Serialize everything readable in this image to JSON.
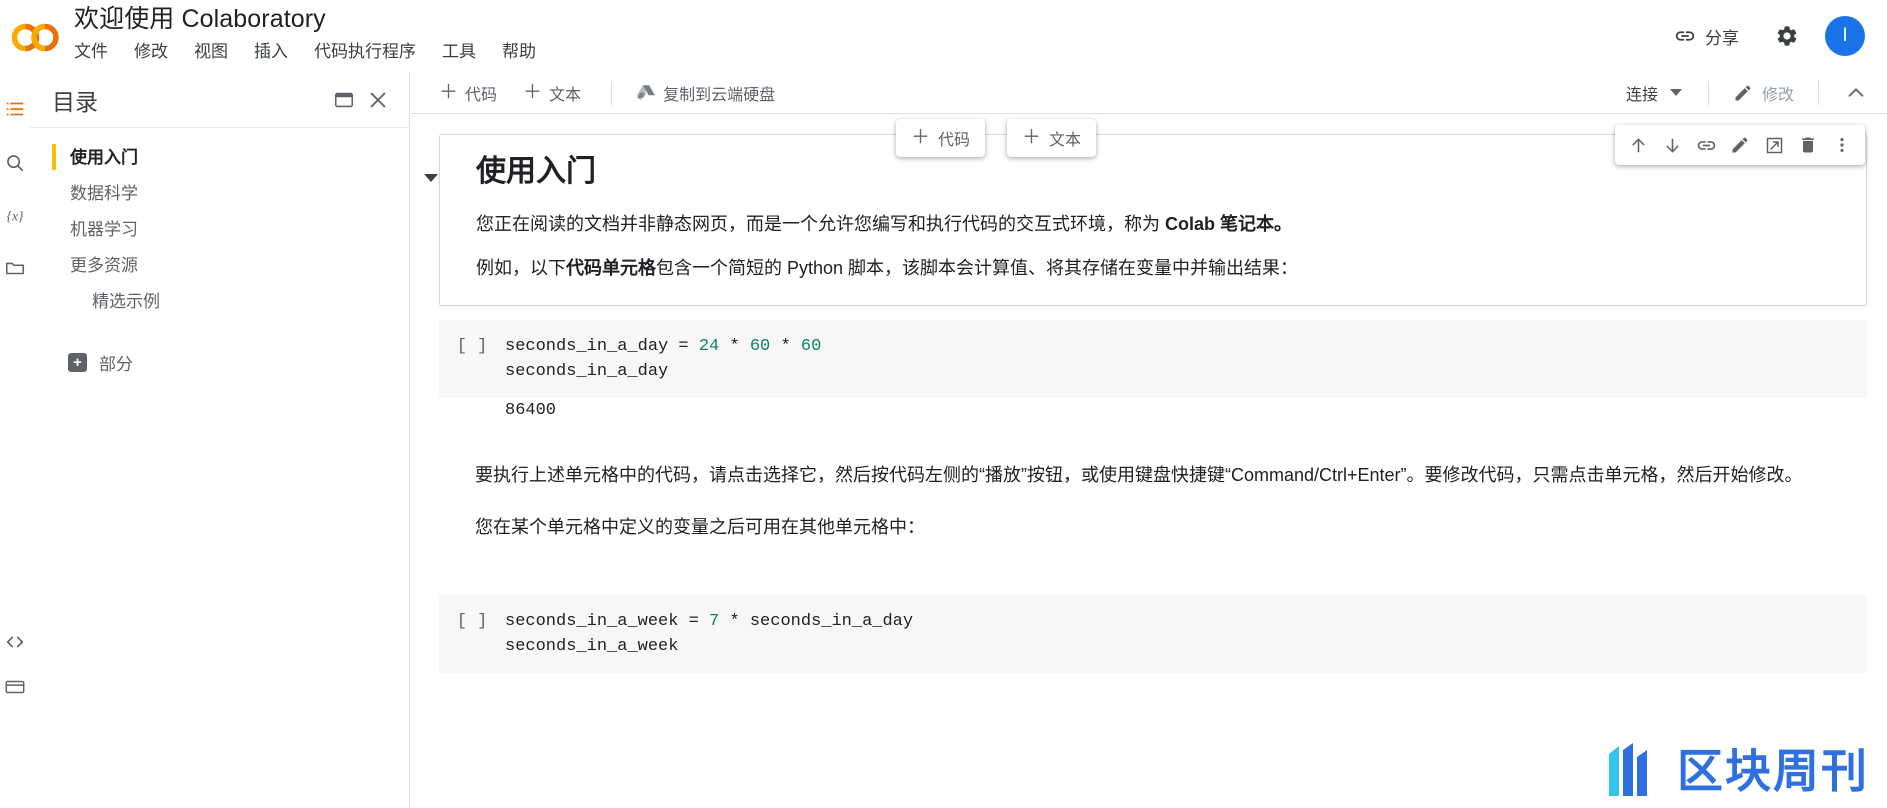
{
  "header": {
    "doc_title": "欢迎使用 Colaboratory",
    "logo_name": "colab-logo",
    "menu": [
      {
        "label": "文件"
      },
      {
        "label": "修改"
      },
      {
        "label": "视图"
      },
      {
        "label": "插入"
      },
      {
        "label": "代码执行程序"
      },
      {
        "label": "工具"
      },
      {
        "label": "帮助"
      }
    ],
    "share_label": "分享",
    "share_icon": "link-icon",
    "settings_icon": "gear-icon",
    "avatar_initial": "I",
    "avatar_color": "#1a73e8"
  },
  "icon_rail": {
    "items": [
      {
        "name": "toc-icon",
        "glyph": "list",
        "active": true
      },
      {
        "name": "search-icon",
        "glyph": "search",
        "active": false
      },
      {
        "name": "variables-icon",
        "glyph": "{x}",
        "active": false
      },
      {
        "name": "files-icon",
        "glyph": "folder",
        "active": false
      }
    ],
    "bottom_items": [
      {
        "name": "code-snippets-icon",
        "glyph": "<>"
      },
      {
        "name": "terminal-icon",
        "glyph": "terminal"
      }
    ],
    "active_color": "#e8710a"
  },
  "toc": {
    "title": "目录",
    "panel_icon": "open-in-window-icon",
    "close_icon": "close-icon",
    "items": [
      {
        "label": "使用入门",
        "level": 1,
        "selected": true
      },
      {
        "label": "数据科学",
        "level": 1,
        "selected": false
      },
      {
        "label": "机器学习",
        "level": 1,
        "selected": false
      },
      {
        "label": "更多资源",
        "level": 1,
        "selected": false
      },
      {
        "label": "精选示例",
        "level": 2,
        "selected": false
      }
    ],
    "sections_label": "部分",
    "sections_icon": "plus-box-icon",
    "selected_marker_color": "#fbbc04"
  },
  "toolbar": {
    "add_code_label": "代码",
    "add_text_label": "文本",
    "copy_to_drive_label": "复制到云端硬盘",
    "drive_icon": "google-drive-icon",
    "connect_label": "连接",
    "edit_label": "修改",
    "edit_icon": "pencil-icon",
    "collapse_icon": "chevron-up-icon"
  },
  "float_buttons": {
    "add_code_label": "代码",
    "add_text_label": "文本"
  },
  "cell_actions": [
    {
      "name": "move-cell-up-icon",
      "glyph": "arrow-up"
    },
    {
      "name": "move-cell-down-icon",
      "glyph": "arrow-down"
    },
    {
      "name": "link-to-cell-icon",
      "glyph": "link"
    },
    {
      "name": "edit-cell-icon",
      "glyph": "pencil"
    },
    {
      "name": "open-in-tab-icon",
      "glyph": "open-in-new"
    },
    {
      "name": "delete-cell-icon",
      "glyph": "trash"
    },
    {
      "name": "more-options-icon",
      "glyph": "kebab"
    }
  ],
  "notebook": {
    "markdown_cell": {
      "heading": "使用入门",
      "paragraph1_a": "您正在阅读的文档并非静态网页，而是一个允许您编写和执行代码的交互式环境，称为 ",
      "paragraph1_b": "Colab 笔记本。",
      "paragraph2_a": "例如，以下",
      "paragraph2_b": "代码单元格",
      "paragraph2_c": "包含一个简短的 Python 脚本，该脚本会计算值、将其存储在变量中并输出结果："
    },
    "code_cell_1": {
      "prompt": "[ ]",
      "line1_var": "seconds_in_a_day",
      "line1_eq": " = ",
      "line1_n1": "24",
      "line1_op1": " * ",
      "line1_n2": "60",
      "line1_op2": " * ",
      "line1_n3": "60",
      "line2": "seconds_in_a_day",
      "output": "86400"
    },
    "text_after": {
      "paragraph3": "要执行上述单元格中的代码，请点击选择它，然后按代码左侧的“播放”按钮，或使用键盘快捷键“Command/Ctrl+Enter”。要修改代码，只需点击单元格，然后开始修改。",
      "paragraph4": "您在某个单元格中定义的变量之后可用在其他单元格中："
    },
    "code_cell_2": {
      "prompt": "[ ]",
      "line1_var": "seconds_in_a_week",
      "line1_eq": " = ",
      "line1_n1": "7",
      "line1_op1": " * ",
      "line1_ref": "seconds_in_a_day",
      "line2": "seconds_in_a_week"
    }
  },
  "watermark": {
    "text": "区块周刊",
    "color": "#2f6fe0",
    "accent": "#33c5e8"
  }
}
